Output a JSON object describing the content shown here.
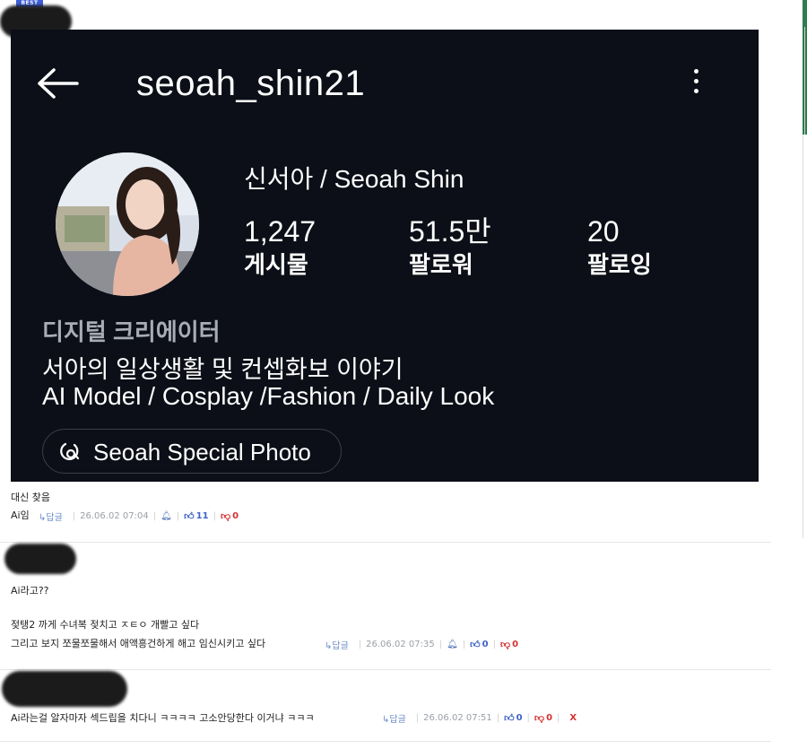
{
  "badge": "BEST",
  "profile": {
    "username": "seoah_shin21",
    "display_name": "신서아 / Seoah Shin",
    "stats": [
      {
        "value": "1,247",
        "label": "게시물"
      },
      {
        "value": "51.5만",
        "label": "팔로워"
      },
      {
        "value": "20",
        "label": "팔로잉"
      }
    ],
    "category": "디지털 크리에이터",
    "bio_line1": "서아의 일상생활 및 컨셉화보 이야기",
    "bio_line2": "AI Model / Cosplay /Fashion / Daily Look",
    "link_label": "Seoah Special Photo"
  },
  "comments": [
    {
      "lines": [
        "대신 찾음",
        "Ai임"
      ],
      "reply": "↳답글",
      "timestamp": "26.06.02 07:04",
      "likes": "11",
      "dislikes": "0"
    },
    {
      "lines": [
        "Ai라고??",
        "젖탱2 까게 수녀복 젖치고 ㅈㅌㅇ 개빨고 싶다",
        "그리고 보지 쪼물쪼물해서 애액흥건하게 해고 임신시키고 싶다"
      ],
      "reply": "↳답글",
      "timestamp": "26.06.02 07:35",
      "likes": "0",
      "dislikes": "0"
    },
    {
      "lines": [
        "Ai라는걸 알자마자 섹드립을 치다니 ㅋㅋㅋㅋ 고소안당한다 이거냐 ㅋㅋㅋ"
      ],
      "reply": "↳답글",
      "timestamp": "26.06.02 07:51",
      "likes": "0",
      "dislikes": "0",
      "delete": "X"
    }
  ],
  "colors": {
    "profile_bg": "#0c0f17",
    "like": "#3e63c7",
    "dislike": "#d63030",
    "badge": "#3d5fd9"
  }
}
